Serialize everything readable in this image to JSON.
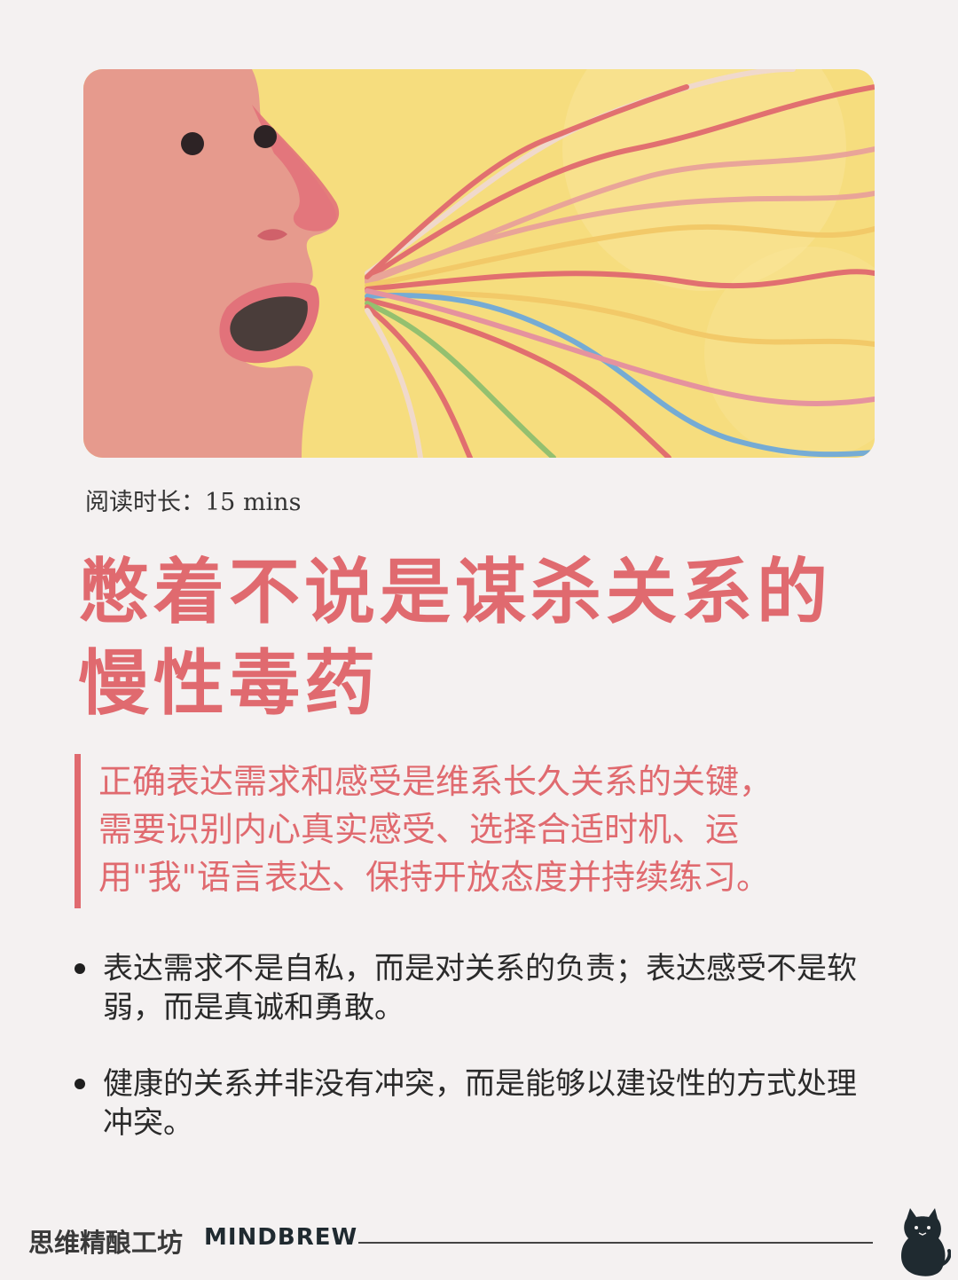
{
  "hero": {
    "image_description_icon": "person-speaking-illustration-icon",
    "colors": {
      "background": "#f6dd7e",
      "face": "#e69a8d",
      "accent": "#e06a6f"
    }
  },
  "meta": {
    "reading_time": "阅读时长：15 mins"
  },
  "title": {
    "line1": "憋着不说是谋杀关系的",
    "line2": "慢性毒药"
  },
  "quote": {
    "line1": "正确表达需求和感受是维系长久关系的关键，",
    "line2": "需要识别内心真实感受、选择合适时机、运",
    "line3": "用\"我\"语言表达、保持开放态度并持续练习。"
  },
  "bullets": [
    {
      "text": "表达需求不是自私，而是对关系的负责；表达感受不是软弱，而是真诚和勇敢。"
    },
    {
      "text": "健康的关系并非没有冲突，而是能够以建设性的方式处理冲突。"
    }
  ],
  "footer": {
    "brand_cn": "思维精酿工坊",
    "brand_en": "MINDBREW",
    "logo_icon": "cat-logo-icon"
  },
  "colors": {
    "page_bg": "#f4f1f1",
    "accent": "#e06a6f",
    "text": "#2a2a2a"
  }
}
